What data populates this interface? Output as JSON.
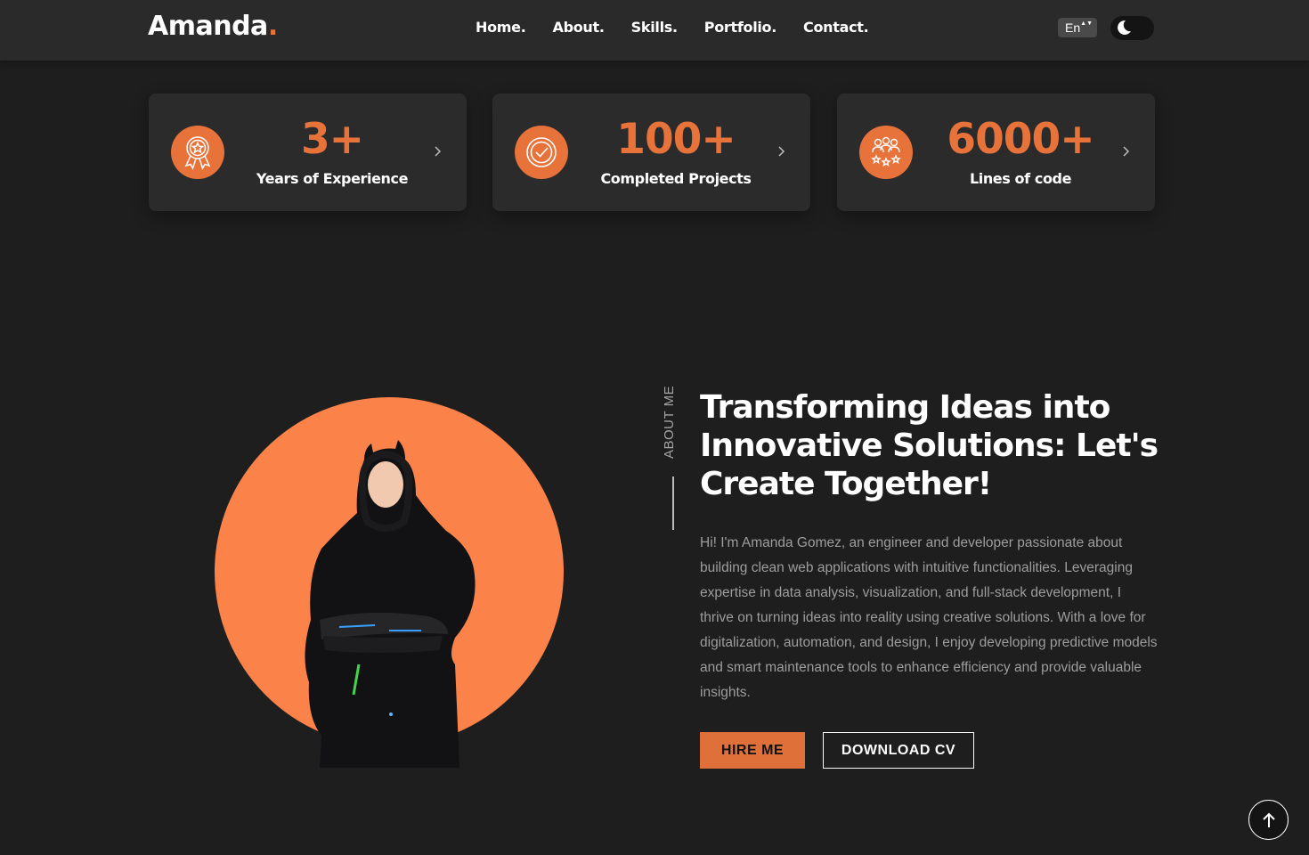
{
  "nav": {
    "logo_text": "Amanda",
    "logo_dot": ".",
    "links": [
      "Home.",
      "About.",
      "Skills.",
      "Portfolio.",
      "Contact."
    ],
    "language_selected": "En"
  },
  "stats": [
    {
      "value": "3+",
      "label": "Years of Experience",
      "icon": "award-icon"
    },
    {
      "value": "100+",
      "label": "Completed Projects",
      "icon": "check-badge-icon"
    },
    {
      "value": "6000+",
      "label": "Lines of code",
      "icon": "team-stars-icon"
    }
  ],
  "about": {
    "side_label": "ABOUT ME",
    "headline": "Transforming Ideas into Innovative Solutions: Let's Create Together!",
    "bio": "Hi! I'm Amanda Gomez, an engineer and developer passionate about building clean web applications with intuitive functionalities. Leveraging expertise in data analysis, visualization, and full-stack development, I thrive on turning ideas into reality using creative solutions. With a love for digitalization, automation, and design, I enjoy developing predictive models and smart maintenance tools to enhance efficiency and provide valuable insights.",
    "hire_label": "HIRE ME",
    "cv_label": "DOWNLOAD CV"
  },
  "colors": {
    "accent": "#e8733a",
    "background": "#1e1e1f",
    "card": "#2b2b2c"
  }
}
